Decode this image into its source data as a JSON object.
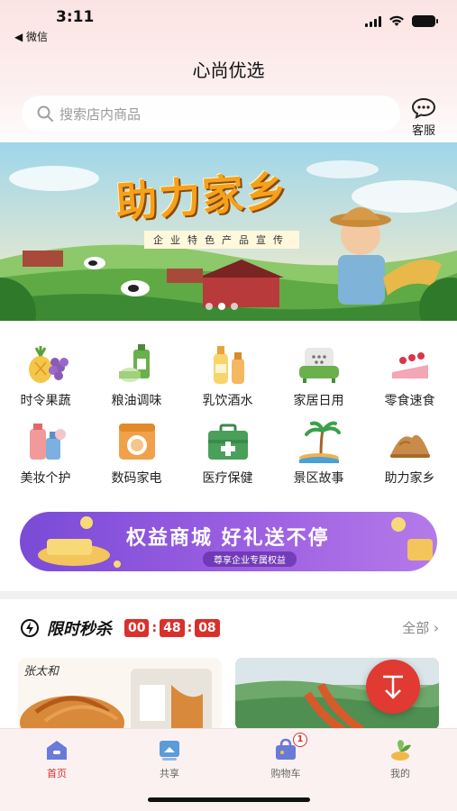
{
  "status_bar": {
    "time": "3:11",
    "back_label": "◀ 微信"
  },
  "page": {
    "title": "心尚优选"
  },
  "search": {
    "placeholder": "搜索店内商品",
    "service_label": "客服"
  },
  "banner": {
    "title": "助力家乡",
    "subtitle": "企业特色产品宣传",
    "slide_count": 3,
    "active_slide": 1
  },
  "categories": [
    {
      "label": "时令果蔬",
      "icon": "fruit-icon"
    },
    {
      "label": "粮油调味",
      "icon": "oil-icon"
    },
    {
      "label": "乳饮酒水",
      "icon": "drink-icon"
    },
    {
      "label": "家居日用",
      "icon": "sofa-icon"
    },
    {
      "label": "零食速食",
      "icon": "cake-icon"
    },
    {
      "label": "美妆个护",
      "icon": "cosmetics-icon"
    },
    {
      "label": "数码家电",
      "icon": "washer-icon"
    },
    {
      "label": "医疗保健",
      "icon": "medical-kit-icon"
    },
    {
      "label": "景区故事",
      "icon": "island-icon"
    },
    {
      "label": "助力家乡",
      "icon": "mountain-icon"
    }
  ],
  "promo": {
    "title": "权益商城 好礼送不停",
    "subtitle": "尊享企业专属权益"
  },
  "flash_sale": {
    "title": "限时秒杀",
    "countdown": {
      "hours": "00",
      "minutes": "48",
      "seconds": "08"
    },
    "more_label": "全部 ›"
  },
  "products": [
    {
      "brand_text": "张太和"
    },
    {
      "brand_text": ""
    }
  ],
  "tabbar": {
    "items": [
      {
        "label": "首页",
        "icon": "home-icon",
        "active": true
      },
      {
        "label": "共享",
        "icon": "share-icon",
        "active": false
      },
      {
        "label": "购物车",
        "icon": "cart-icon",
        "active": false,
        "badge": "1"
      },
      {
        "label": "我的",
        "icon": "profile-icon",
        "active": false
      }
    ]
  },
  "colors": {
    "accent": "#d9302c",
    "promo": "#8e57dd",
    "banner_title": "#f5a11b"
  }
}
